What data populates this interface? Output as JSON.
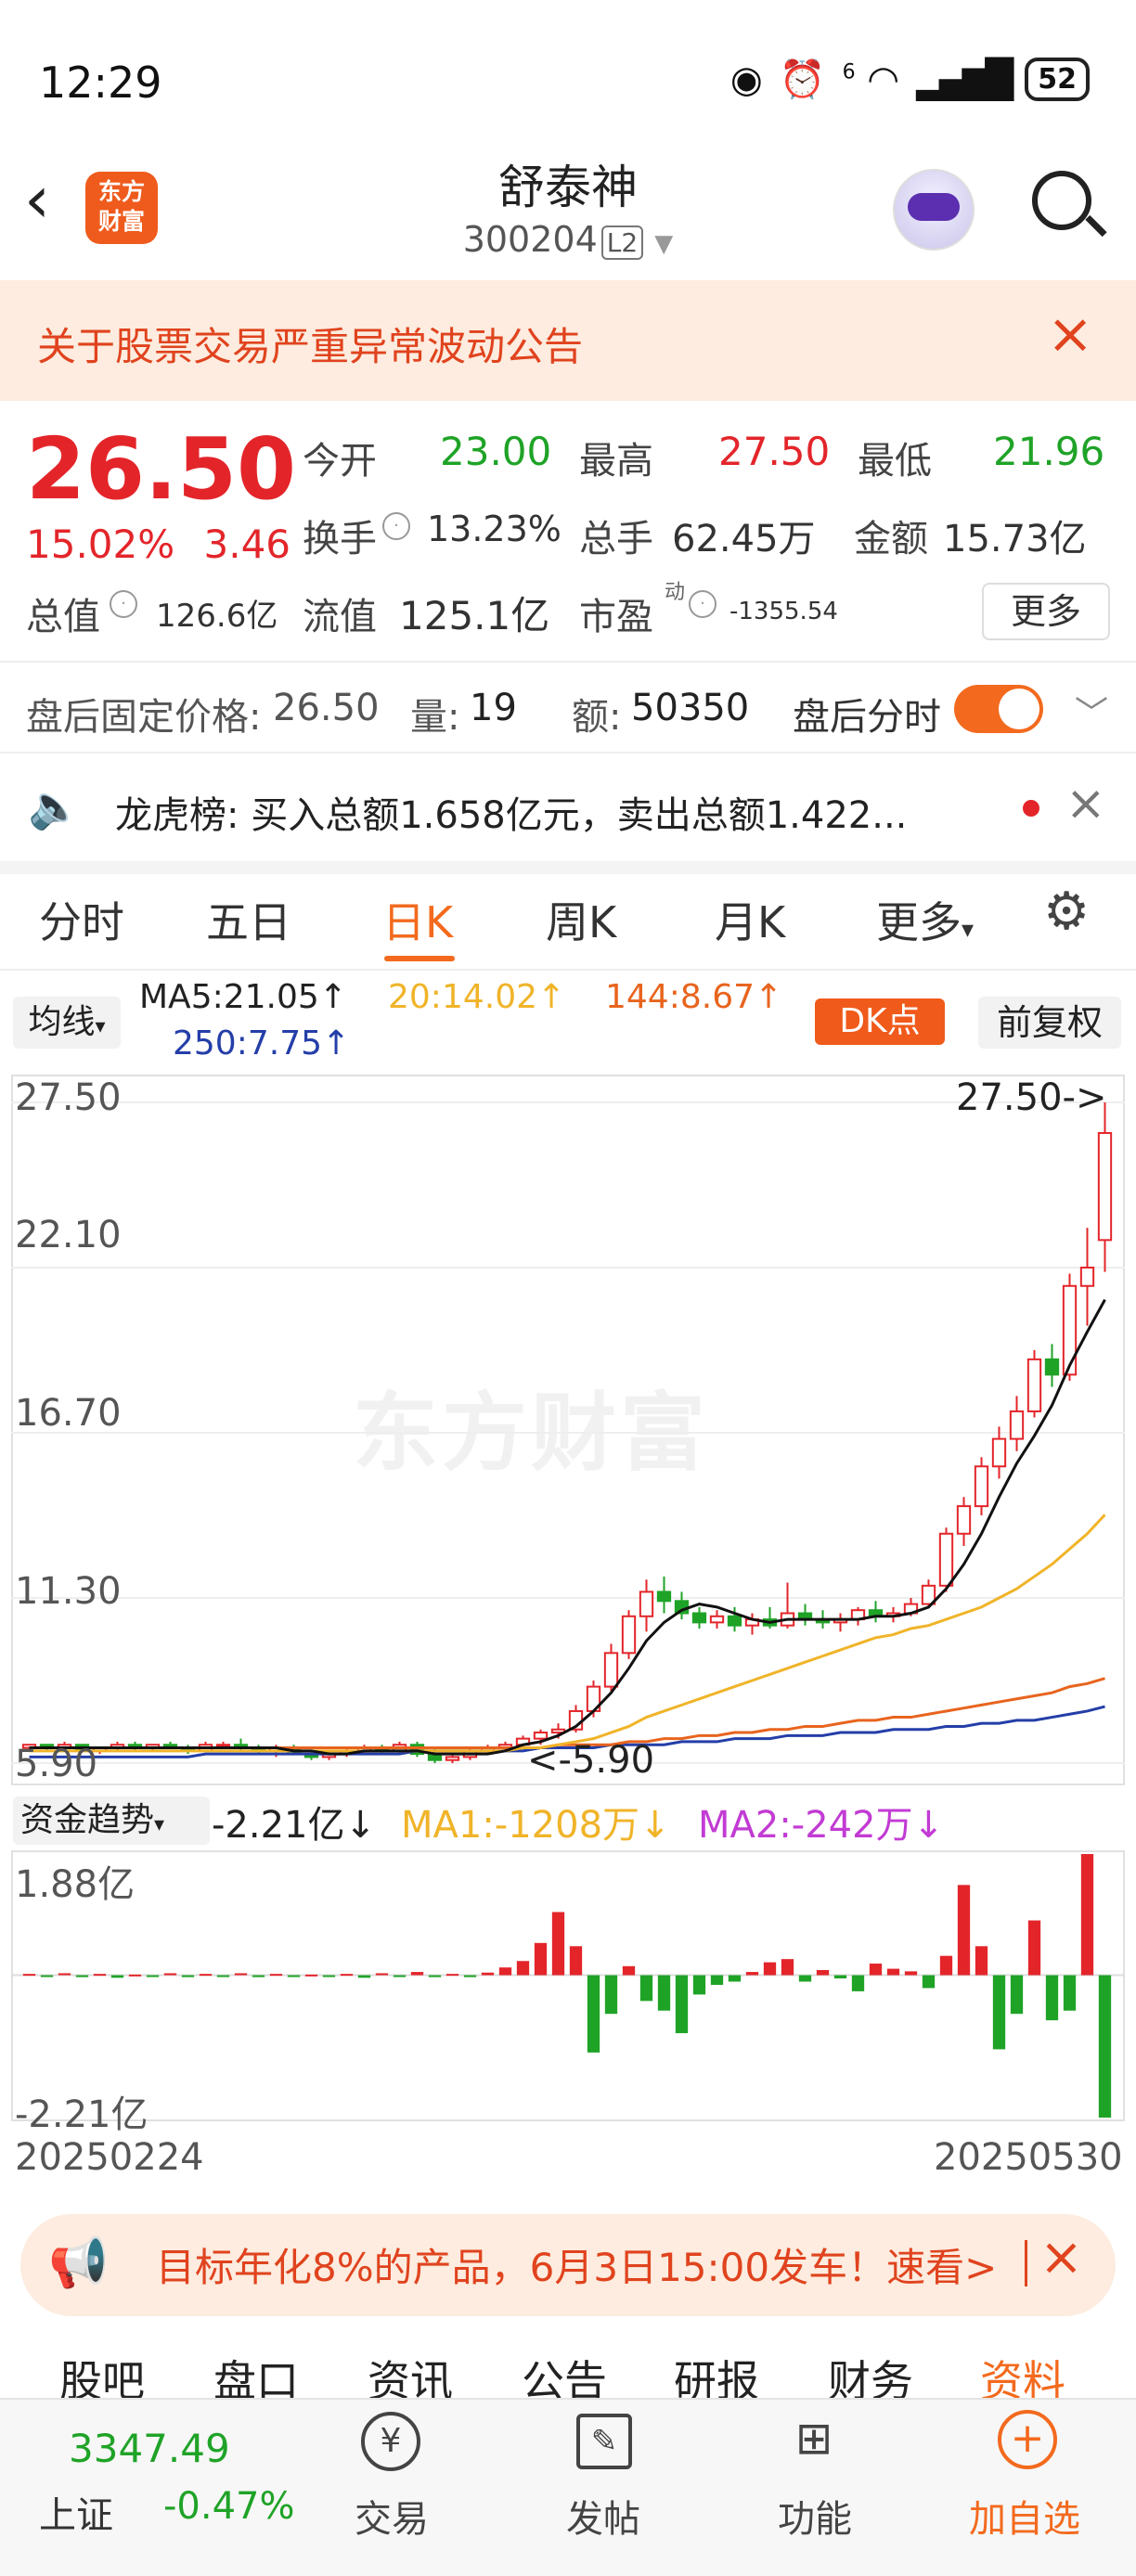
{
  "status_bar": {
    "time": "12:29",
    "battery": "52",
    "signal": "6"
  },
  "header": {
    "title": "舒泰神",
    "code": "300204",
    "level": "L2"
  },
  "notice": {
    "text": "关于股票交易严重异常波动公告"
  },
  "quote": {
    "price": "26.50",
    "change_pct": "15.02%",
    "change": "3.46",
    "open_label": "今开",
    "open": "23.00",
    "high_label": "最高",
    "high": "27.50",
    "low_label": "最低",
    "low": "21.96",
    "turnover_label": "换手",
    "turnover": "13.23%",
    "volume_label": "总手",
    "volume": "62.45万",
    "amount_label": "金额",
    "amount": "15.73亿",
    "mktcap_label": "总值",
    "mktcap": "126.6亿",
    "float_label": "流值",
    "float": "125.1亿",
    "pe_label": "市盈",
    "pe_sup": "动",
    "pe": "-1355.54",
    "more": "更多"
  },
  "after_hours": {
    "price_label": "盘后固定价格:",
    "price": "26.50",
    "vol_label": "量:",
    "vol": "19",
    "amt_label": "额:",
    "amt": "50350",
    "toggle_label": "盘后分时"
  },
  "lhb": {
    "label": "龙虎榜:",
    "text": "买入总额1.658亿元，卖出总额1.422..."
  },
  "period_tabs": [
    "分时",
    "五日",
    "日K",
    "周K",
    "月K",
    "更多"
  ],
  "indicators": {
    "ma_button": "均线",
    "ma5": "MA5:21.05↑",
    "ma20": "20:14.02↑",
    "ma144": "144:8.67↑",
    "ma250": "250:7.75↑",
    "dk": "DK点",
    "adjust": "前复权"
  },
  "colors": {
    "up": "#e3252a",
    "down": "#1fa327",
    "accent": "#f36a1e",
    "ma20": "#f0b429",
    "ma144": "#e8641e",
    "ma250": "#243ea8",
    "ma2": "#c23bd4"
  },
  "chart_data": {
    "type": "candlestick",
    "y_ticks": [
      "27.50",
      "22.10",
      "16.70",
      "11.30",
      "5.90"
    ],
    "ylim": [
      5.9,
      27.5
    ],
    "max_label": "27.50->",
    "min_label": "<-5.90",
    "x_start": "20250224",
    "x_end": "20250530",
    "candles": [
      [
        6.4,
        6.5,
        6.3,
        6.5
      ],
      [
        6.5,
        6.5,
        6.3,
        6.4
      ],
      [
        6.4,
        6.6,
        6.3,
        6.5
      ],
      [
        6.5,
        6.5,
        6.3,
        6.3
      ],
      [
        6.3,
        6.4,
        6.2,
        6.4
      ],
      [
        6.4,
        6.6,
        6.3,
        6.5
      ],
      [
        6.5,
        6.6,
        6.3,
        6.4
      ],
      [
        6.4,
        6.5,
        6.3,
        6.5
      ],
      [
        6.5,
        6.6,
        6.4,
        6.4
      ],
      [
        6.4,
        6.5,
        6.2,
        6.3
      ],
      [
        6.3,
        6.6,
        6.3,
        6.5
      ],
      [
        6.5,
        6.6,
        6.4,
        6.5
      ],
      [
        6.5,
        6.7,
        6.3,
        6.4
      ],
      [
        6.4,
        6.5,
        6.2,
        6.3
      ],
      [
        6.3,
        6.5,
        6.1,
        6.4
      ],
      [
        6.4,
        6.5,
        6.2,
        6.2
      ],
      [
        6.2,
        6.3,
        6.0,
        6.1
      ],
      [
        6.1,
        6.3,
        6.0,
        6.2
      ],
      [
        6.2,
        6.4,
        6.1,
        6.3
      ],
      [
        6.3,
        6.5,
        6.2,
        6.4
      ],
      [
        6.4,
        6.5,
        6.2,
        6.3
      ],
      [
        6.3,
        6.6,
        6.2,
        6.5
      ],
      [
        6.5,
        6.6,
        6.1,
        6.2
      ],
      [
        6.2,
        6.4,
        5.9,
        6.0
      ],
      [
        6.0,
        6.2,
        5.9,
        6.1
      ],
      [
        6.1,
        6.4,
        6.0,
        6.3
      ],
      [
        6.3,
        6.5,
        6.2,
        6.4
      ],
      [
        6.4,
        6.6,
        6.3,
        6.5
      ],
      [
        6.5,
        6.8,
        6.4,
        6.7
      ],
      [
        6.7,
        7.0,
        6.5,
        6.9
      ],
      [
        6.9,
        7.2,
        6.7,
        7.0
      ],
      [
        7.0,
        7.8,
        6.9,
        7.6
      ],
      [
        7.6,
        8.6,
        7.4,
        8.4
      ],
      [
        8.4,
        9.8,
        8.2,
        9.5
      ],
      [
        9.5,
        10.9,
        9.3,
        10.7
      ],
      [
        10.7,
        11.9,
        10.2,
        11.5
      ],
      [
        11.5,
        12.0,
        10.8,
        11.2
      ],
      [
        11.2,
        11.5,
        10.6,
        10.8
      ],
      [
        10.8,
        11.0,
        10.3,
        10.5
      ],
      [
        10.5,
        10.9,
        10.3,
        10.7
      ],
      [
        10.7,
        11.0,
        10.2,
        10.4
      ],
      [
        10.4,
        10.8,
        10.1,
        10.6
      ],
      [
        10.6,
        11.0,
        10.3,
        10.4
      ],
      [
        10.4,
        11.8,
        10.3,
        10.8
      ],
      [
        10.8,
        11.1,
        10.4,
        10.6
      ],
      [
        10.6,
        10.9,
        10.3,
        10.5
      ],
      [
        10.5,
        10.8,
        10.2,
        10.6
      ],
      [
        10.6,
        11.0,
        10.4,
        10.9
      ],
      [
        10.9,
        11.2,
        10.5,
        10.7
      ],
      [
        10.7,
        11.0,
        10.5,
        10.8
      ],
      [
        10.8,
        11.3,
        10.7,
        11.1
      ],
      [
        11.1,
        11.9,
        11.0,
        11.7
      ],
      [
        11.7,
        13.6,
        11.5,
        13.4
      ],
      [
        13.4,
        14.6,
        13.0,
        14.3
      ],
      [
        14.3,
        15.9,
        14.0,
        15.6
      ],
      [
        15.6,
        16.9,
        15.2,
        16.5
      ],
      [
        16.5,
        17.9,
        16.1,
        17.4
      ],
      [
        17.4,
        19.4,
        17.2,
        19.1
      ],
      [
        19.1,
        19.6,
        18.2,
        18.6
      ],
      [
        18.6,
        21.9,
        18.4,
        21.5
      ],
      [
        21.5,
        23.4,
        20.2,
        22.1
      ],
      [
        23.0,
        27.5,
        21.96,
        26.5
      ]
    ],
    "ma5": [
      6.4,
      6.4,
      6.4,
      6.4,
      6.4,
      6.4,
      6.4,
      6.4,
      6.4,
      6.4,
      6.4,
      6.4,
      6.4,
      6.4,
      6.4,
      6.3,
      6.3,
      6.2,
      6.2,
      6.3,
      6.3,
      6.3,
      6.3,
      6.2,
      6.2,
      6.2,
      6.2,
      6.3,
      6.5,
      6.6,
      6.8,
      7.1,
      7.6,
      8.2,
      9.0,
      9.9,
      10.5,
      10.9,
      11.1,
      11.0,
      10.8,
      10.6,
      10.5,
      10.6,
      10.6,
      10.6,
      10.6,
      10.6,
      10.7,
      10.7,
      10.8,
      11.0,
      11.6,
      12.4,
      13.4,
      14.6,
      15.7,
      16.6,
      17.6,
      18.9,
      20.0,
      21.05
    ],
    "ma20": [
      6.3,
      6.3,
      6.3,
      6.3,
      6.3,
      6.3,
      6.3,
      6.3,
      6.3,
      6.3,
      6.3,
      6.3,
      6.3,
      6.3,
      6.3,
      6.3,
      6.3,
      6.3,
      6.3,
      6.3,
      6.3,
      6.3,
      6.3,
      6.3,
      6.3,
      6.3,
      6.3,
      6.3,
      6.4,
      6.4,
      6.5,
      6.6,
      6.7,
      6.9,
      7.1,
      7.4,
      7.6,
      7.8,
      8.0,
      8.2,
      8.4,
      8.6,
      8.8,
      9.0,
      9.2,
      9.4,
      9.6,
      9.8,
      10.0,
      10.1,
      10.3,
      10.4,
      10.6,
      10.8,
      11.0,
      11.3,
      11.6,
      12.0,
      12.4,
      12.9,
      13.4,
      14.02
    ],
    "ma144": [
      6.4,
      6.4,
      6.4,
      6.4,
      6.4,
      6.4,
      6.4,
      6.4,
      6.4,
      6.4,
      6.4,
      6.4,
      6.4,
      6.4,
      6.4,
      6.4,
      6.4,
      6.4,
      6.4,
      6.4,
      6.4,
      6.4,
      6.4,
      6.4,
      6.4,
      6.4,
      6.4,
      6.4,
      6.4,
      6.4,
      6.5,
      6.5,
      6.5,
      6.5,
      6.6,
      6.6,
      6.7,
      6.7,
      6.8,
      6.8,
      6.9,
      6.9,
      7.0,
      7.0,
      7.1,
      7.1,
      7.2,
      7.3,
      7.3,
      7.4,
      7.4,
      7.5,
      7.6,
      7.7,
      7.8,
      7.9,
      8.0,
      8.1,
      8.2,
      8.4,
      8.5,
      8.67
    ],
    "ma250": [
      6.1,
      6.1,
      6.1,
      6.1,
      6.1,
      6.1,
      6.1,
      6.1,
      6.1,
      6.1,
      6.2,
      6.2,
      6.2,
      6.2,
      6.2,
      6.2,
      6.2,
      6.2,
      6.2,
      6.2,
      6.2,
      6.2,
      6.3,
      6.3,
      6.3,
      6.3,
      6.3,
      6.3,
      6.3,
      6.4,
      6.4,
      6.4,
      6.4,
      6.5,
      6.5,
      6.5,
      6.5,
      6.6,
      6.6,
      6.6,
      6.7,
      6.7,
      6.7,
      6.8,
      6.8,
      6.8,
      6.9,
      6.9,
      6.9,
      7.0,
      7.0,
      7.0,
      7.1,
      7.1,
      7.2,
      7.2,
      7.3,
      7.3,
      7.4,
      7.5,
      7.6,
      7.75
    ]
  },
  "fund_flow": {
    "label": "资金趋势",
    "value": "-2.21亿↓",
    "ma1": "MA1:-1208万↓",
    "ma2": "MA2:-242万↓",
    "top_label": "1.88亿",
    "bottom_label": "-2.21亿",
    "ylim": [
      -2.21,
      1.88
    ],
    "values": [
      0.02,
      -0.02,
      0.03,
      -0.03,
      0.02,
      -0.04,
      0.01,
      -0.02,
      0.03,
      -0.03,
      0.02,
      -0.02,
      0.03,
      -0.03,
      0.02,
      -0.02,
      0.01,
      -0.01,
      0.02,
      -0.04,
      0.03,
      -0.02,
      0.05,
      -0.03,
      0.02,
      -0.03,
      0.04,
      0.12,
      0.22,
      0.5,
      0.98,
      0.45,
      -1.2,
      -0.6,
      0.14,
      -0.4,
      -0.55,
      -0.9,
      -0.3,
      -0.15,
      -0.1,
      0.05,
      0.2,
      0.25,
      -0.1,
      0.08,
      -0.05,
      -0.25,
      0.18,
      0.1,
      0.06,
      -0.2,
      0.3,
      1.4,
      0.45,
      -1.15,
      -0.6,
      0.85,
      -0.7,
      -0.55,
      1.88,
      -2.21
    ]
  },
  "promo": {
    "text": "目标年化8%的产品，6月3日15:00发车！速看>"
  },
  "sub_tabs": [
    "股吧",
    "盘口",
    "资讯",
    "公告",
    "研报",
    "财务",
    "资料"
  ],
  "bottom_bar": {
    "index_value": "3347.49",
    "index_name": "上证",
    "index_change": "-0.47%",
    "items": [
      {
        "label": "交易",
        "icon": "yen-icon"
      },
      {
        "label": "发帖",
        "icon": "edit-icon"
      },
      {
        "label": "功能",
        "icon": "grid-icon"
      },
      {
        "label": "加自选",
        "icon": "plus-icon"
      }
    ]
  }
}
